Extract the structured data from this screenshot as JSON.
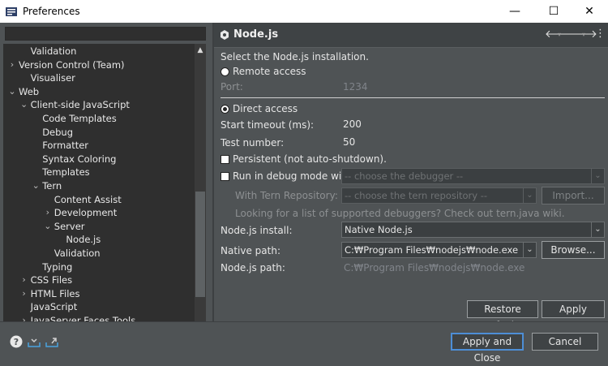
{
  "window": {
    "title": "Preferences",
    "controls": {
      "minimize": "—",
      "maximize": "☐",
      "close": "✕"
    }
  },
  "tree": {
    "items": [
      {
        "label": "Validation",
        "depth": 1,
        "twisty": ""
      },
      {
        "label": "Version Control (Team)",
        "depth": 0,
        "twisty": ">"
      },
      {
        "label": "Visualiser",
        "depth": 1,
        "twisty": ""
      },
      {
        "label": "Web",
        "depth": 0,
        "twisty": "v"
      },
      {
        "label": "Client-side JavaScript",
        "depth": 1,
        "twisty": "v"
      },
      {
        "label": "Code Templates",
        "depth": 2,
        "twisty": ""
      },
      {
        "label": "Debug",
        "depth": 2,
        "twisty": ""
      },
      {
        "label": "Formatter",
        "depth": 2,
        "twisty": ""
      },
      {
        "label": "Syntax Coloring",
        "depth": 2,
        "twisty": ""
      },
      {
        "label": "Templates",
        "depth": 2,
        "twisty": ""
      },
      {
        "label": "Tern",
        "depth": 2,
        "twisty": "v"
      },
      {
        "label": "Content Assist",
        "depth": 3,
        "twisty": ""
      },
      {
        "label": "Development",
        "depth": 3,
        "twisty": ">"
      },
      {
        "label": "Server",
        "depth": 3,
        "twisty": "v"
      },
      {
        "label": "Node.js",
        "depth": 4,
        "twisty": ""
      },
      {
        "label": "Validation",
        "depth": 3,
        "twisty": ""
      },
      {
        "label": "Typing",
        "depth": 2,
        "twisty": ""
      },
      {
        "label": "CSS Files",
        "depth": 1,
        "twisty": ">"
      },
      {
        "label": "HTML Files",
        "depth": 1,
        "twisty": ">"
      },
      {
        "label": "JavaScript",
        "depth": 1,
        "twisty": ""
      },
      {
        "label": "JavaServer Faces Tools",
        "depth": 1,
        "twisty": ">"
      }
    ]
  },
  "page": {
    "title": "Node.js",
    "intro": "Select the Node.js installation.",
    "remote_access": "Remote access",
    "port_label": "Port:",
    "port_value": "1234",
    "direct_access": "Direct access",
    "start_timeout_label": "Start timeout (ms):",
    "start_timeout_value": "200",
    "test_number_label": "Test number:",
    "test_number_value": "50",
    "persistent_label": "Persistent (not auto-shutdown).",
    "debug_mode_label": "Run in debug mode with:",
    "debugger_combo": "-- choose the debugger --",
    "tern_repo_label": "With Tern Repository:",
    "tern_repo_combo": "-- choose the tern repository --",
    "import_button": "Import...",
    "debuggers_hint": "Looking for a list of supported debuggers? Check out tern.java wiki.",
    "nodejs_install_label": "Node.js install:",
    "nodejs_install_value": "Native Node.js",
    "native_path_label": "Native path:",
    "native_path_value": "C:₩Program Files₩nodejs₩node.exe",
    "browse_button": "Browse...",
    "nodejs_path_label": "Node.js path:",
    "nodejs_path_value": "C:₩Program Files₩nodejs₩node.exe",
    "restore_defaults_button": "Restore Defaults",
    "apply_button": "Apply"
  },
  "footer": {
    "apply_close_button": "Apply and Close",
    "cancel_button": "Cancel"
  }
}
